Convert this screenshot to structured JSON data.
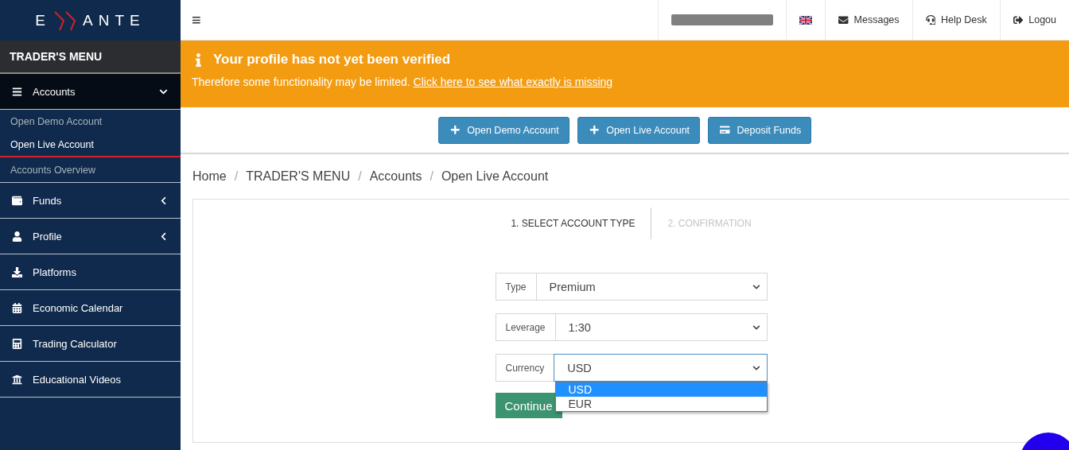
{
  "logo": {
    "left": "E",
    "right": "ANTE"
  },
  "sidebar": {
    "heading": "TRADER'S MENU",
    "items": [
      {
        "label": "Accounts",
        "expanded": true,
        "selected": true,
        "children": [
          {
            "label": "Open Demo Account",
            "selected": false
          },
          {
            "label": "Open Live Account",
            "selected": true
          },
          {
            "label": "Accounts Overview",
            "selected": false
          }
        ]
      },
      {
        "label": "Funds",
        "expanded": false,
        "selected": false
      },
      {
        "label": "Profile",
        "expanded": false,
        "selected": false
      },
      {
        "label": "Platforms",
        "selected": false
      },
      {
        "label": "Economic Calendar",
        "selected": false
      },
      {
        "label": "Trading Calculator",
        "selected": false
      },
      {
        "label": "Educational Videos",
        "selected": false
      }
    ]
  },
  "topbar": {
    "menu_glyph": "≡",
    "links": [
      {
        "label": "Messages"
      },
      {
        "label": "Help Desk"
      },
      {
        "label": "Logou"
      }
    ]
  },
  "banner": {
    "title": "Your profile has not yet been verified",
    "text": "Therefore some functionality may be limited.",
    "link": "Click here to see what exactly is missing"
  },
  "actions": [
    {
      "label": "Open Demo Account"
    },
    {
      "label": "Open Live Account"
    },
    {
      "label": "Deposit Funds"
    }
  ],
  "breadcrumb": {
    "separator": "/",
    "items": [
      "Home",
      "TRADER'S MENU",
      "Accounts",
      "Open Live Account"
    ]
  },
  "steps": [
    {
      "label": "1. SELECT ACCOUNT TYPE",
      "selected": true
    },
    {
      "label": "2. CONFIRMATION",
      "selected": false
    }
  ],
  "form": {
    "fields": [
      {
        "label": "Type",
        "value": "Premium",
        "focused": false
      },
      {
        "label": "Leverage",
        "value": "1:30",
        "focused": false
      },
      {
        "label": "Currency",
        "value": "USD",
        "focused": true,
        "options": [
          {
            "label": "USD",
            "selected": true
          },
          {
            "label": "EUR",
            "selected": false
          }
        ]
      }
    ],
    "submit": "Continue"
  }
}
